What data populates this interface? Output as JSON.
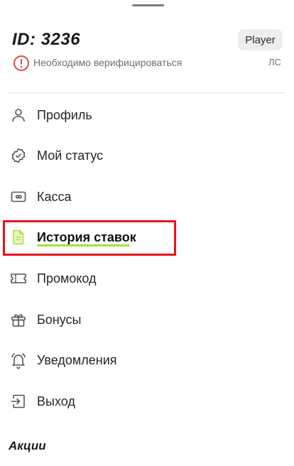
{
  "header": {
    "user_id": "ID: 3236",
    "role_badge": "Player",
    "verify_text": "Необходимо верифицироваться",
    "account_abbr": "ЛС"
  },
  "menu": {
    "items": [
      {
        "label": "Профиль",
        "icon": "user-icon"
      },
      {
        "label": "Мой статус",
        "icon": "status-badge-icon"
      },
      {
        "label": "Касса",
        "icon": "wallet-icon"
      },
      {
        "label": "История ставок",
        "icon": "document-icon",
        "active": true
      },
      {
        "label": "Промокод",
        "icon": "ticket-icon"
      },
      {
        "label": "Бонусы",
        "icon": "gift-icon"
      },
      {
        "label": "Уведомления",
        "icon": "bell-icon"
      },
      {
        "label": "Выход",
        "icon": "logout-icon"
      }
    ]
  },
  "promotions": {
    "heading": "Акции"
  },
  "colors": {
    "accent": "#a8e03a",
    "warning": "#e14b3b",
    "highlight_border": "#e8141b",
    "text": "#262626",
    "muted": "#6e6e6e"
  }
}
